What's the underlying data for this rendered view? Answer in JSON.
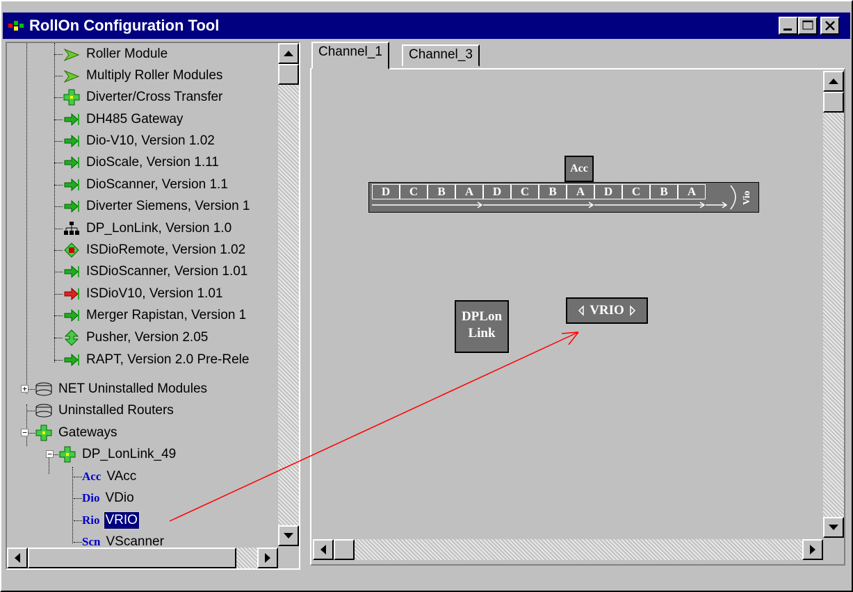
{
  "window": {
    "title": "RollOn Configuration Tool",
    "accent": "#000080"
  },
  "tree": {
    "items": [
      {
        "label": "Roller Module",
        "icon": "roller-module-icon"
      },
      {
        "label": "Multiply Roller Modules",
        "icon": "multiply-roller-icon"
      },
      {
        "label": "Diverter/Cross Transfer",
        "icon": "diverter-cross-icon"
      },
      {
        "label": "DH485 Gateway",
        "icon": "dh485-gateway-icon"
      },
      {
        "label": "Dio-V10, Version 1.02",
        "icon": "dio-v10-icon"
      },
      {
        "label": "DioScale, Version 1.11",
        "icon": "dioscale-icon"
      },
      {
        "label": "DioScanner, Version 1.1",
        "icon": "dioscanner-icon"
      },
      {
        "label": "Diverter Siemens, Version 1",
        "icon": "diverter-siemens-icon"
      },
      {
        "label": "DP_LonLink, Version 1.0",
        "icon": "dp-lonlink-icon"
      },
      {
        "label": "ISDioRemote, Version 1.02",
        "icon": "isdioremote-icon"
      },
      {
        "label": "ISDioScanner, Version 1.01",
        "icon": "isdioscanner-icon"
      },
      {
        "label": "ISDioV10, Version 1.01",
        "icon": "isdiov10-icon"
      },
      {
        "label": "Merger Rapistan, Version 1",
        "icon": "merger-rapistan-icon"
      },
      {
        "label": "Pusher, Version 2.05",
        "icon": "pusher-icon"
      },
      {
        "label": "RAPT, Version 2.0 Pre-Rele",
        "icon": "rapt-icon"
      },
      {
        "label": "NET Uninstalled Modules",
        "icon": "router-icon"
      },
      {
        "label": "Uninstalled Routers",
        "icon": "router-icon"
      },
      {
        "label": "Gateways",
        "icon": "gateway-icon"
      },
      {
        "label": "DP_LonLink_49",
        "icon": "gateway-icon"
      },
      {
        "code": "Acc",
        "label": "VAcc"
      },
      {
        "code": "Dio",
        "label": "VDio"
      },
      {
        "code": "Rio",
        "label": "VRIO"
      },
      {
        "code": "Scn",
        "label": "VScanner"
      }
    ],
    "expanders": {
      "plus": "+",
      "minus": "−"
    }
  },
  "tabs": [
    {
      "label": "Channel_1",
      "active": true
    },
    {
      "label": "Channel_3",
      "active": false
    }
  ],
  "canvas": {
    "bus_cells": [
      "D",
      "C",
      "B",
      "A",
      "D",
      "C",
      "B",
      "A",
      "D",
      "C",
      "B",
      "A"
    ],
    "acc_label": "Acc",
    "vio_label": "Vio",
    "dplon_label_1": "DPLon",
    "dplon_label_2": "Link",
    "vrio_label": "VRIO",
    "arrow_color": "#ff0000"
  }
}
